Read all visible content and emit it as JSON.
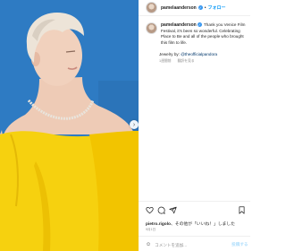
{
  "post": {
    "username": "pamelaanderson",
    "follow_label": "フォロー",
    "separator": "•",
    "more_icon": "ellipsis-icon",
    "caption_text": "Thank you Venice Film Festival, it's been so wonderful. Celebrating Place to Be and all of the people who brought this film to life.",
    "jewelry_label": "Jewelry by:",
    "jewelry_handle": "@theofficialpandora",
    "time_ago": "1週間前",
    "translate_label": "翻訳を見る",
    "likes_user": "pietro.rigolo",
    "likes_suffix": "、その他が「いいね！」しました",
    "date": "9月1日",
    "comment_placeholder": "コメントを追加...",
    "post_button": "投稿する",
    "next_icon": "chevron-right-icon"
  },
  "colors": {
    "sky": "#2d79c0",
    "dress": "#f6d10f",
    "link_blue": "#0095f6",
    "handle_blue": "#00376b",
    "muted": "#8e8e8e"
  }
}
